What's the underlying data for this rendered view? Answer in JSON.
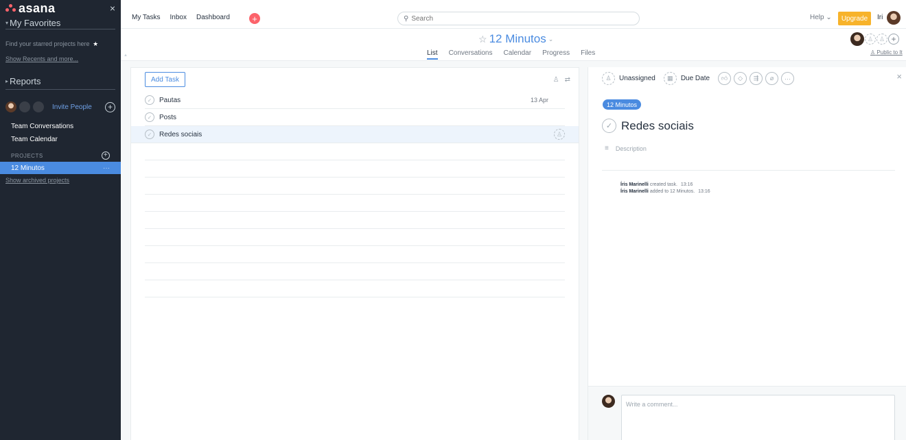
{
  "app": {
    "logo_text": "asana",
    "close_glyph": "×"
  },
  "sidebar": {
    "favorites_title": "My Favorites",
    "favorites_hint": "Find your starred projects here",
    "show_recents": "Show Recents and more...",
    "reports_title": "Reports",
    "invite_label": "Invite People",
    "team_conversations": "Team Conversations",
    "team_calendar": "Team Calendar",
    "projects_heading": "PROJECTS",
    "active_project": "12 Minutos",
    "active_project_more": "···",
    "show_archived": "Show archived projects"
  },
  "topbar": {
    "nav": [
      "My Tasks",
      "Inbox",
      "Dashboard"
    ],
    "search_placeholder": "Search",
    "help_label": "Help ⌄",
    "upgrade_label": "Upgrade",
    "user_short": "Iri"
  },
  "project": {
    "title": "12 Minutos",
    "tabs": [
      "List",
      "Conversations",
      "Calendar",
      "Progress",
      "Files"
    ],
    "active_tab": "List",
    "public_label": "Public to It"
  },
  "list": {
    "add_task_label": "Add Task",
    "tasks": [
      {
        "name": "Pautas",
        "date": "13 Apr"
      },
      {
        "name": "Posts",
        "date": ""
      },
      {
        "name": "Redes sociais",
        "date": ""
      }
    ]
  },
  "detail": {
    "assignee_label": "Unassigned",
    "due_label": "Due Date",
    "project_tag": "12 Minutos",
    "task_title": "Redes sociais",
    "description_placeholder": "Description",
    "activity": [
      {
        "actor": "Íris Marinelli",
        "action": "created task.",
        "time": "13:16"
      },
      {
        "actor": "Íris Marinelli",
        "action": "added to 12 Minutos.",
        "time": "13:16"
      }
    ],
    "comment_placeholder": "Write a comment..."
  },
  "colors": {
    "sidebar_bg": "#1f2631",
    "accent_blue": "#4a8be0",
    "brand_coral": "#fc636b",
    "upgrade_yellow": "#f7b32b"
  }
}
